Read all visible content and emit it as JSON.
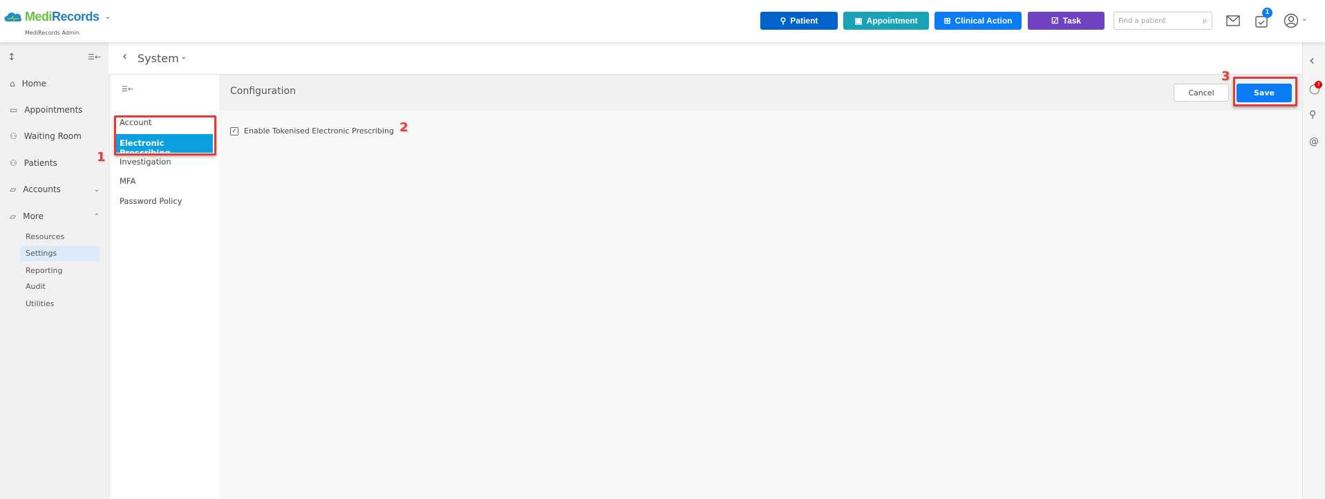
{
  "header": {
    "brand_part1": "Medi",
    "brand_part2": "Records",
    "brand_sub": "MediRecords Admin",
    "buttons": [
      {
        "label": "Patient",
        "icon": "person-add-icon",
        "color": "#0063c9"
      },
      {
        "label": "Appointment",
        "icon": "calendar-add-icon",
        "color": "#17a2b8"
      },
      {
        "label": "Clinical Action",
        "icon": "medical-bag-icon",
        "color": "#0a7cf7"
      },
      {
        "label": "Task",
        "icon": "clipboard-check-icon",
        "color": "#6f42c1"
      }
    ],
    "search_placeholder": "Find a patient",
    "tasks_badge": "1"
  },
  "sidebar": {
    "items": [
      {
        "label": "Home",
        "icon": "home-icon"
      },
      {
        "label": "Appointments",
        "icon": "calendar-icon"
      },
      {
        "label": "Waiting Room",
        "icon": "users-icon"
      },
      {
        "label": "Patients",
        "icon": "patients-icon"
      },
      {
        "label": "Accounts",
        "icon": "folder-icon"
      },
      {
        "label": "More",
        "icon": "folder-plus-icon"
      }
    ],
    "more_items": [
      "Resources",
      "Settings",
      "Reporting",
      "Audit",
      "Utilities"
    ],
    "selected": "Settings"
  },
  "page": {
    "title": "System"
  },
  "subnav": {
    "items": [
      "Account",
      "Electronic Prescribing",
      "Investigation",
      "MFA",
      "Password Policy"
    ],
    "selected": "Electronic Prescribing"
  },
  "config": {
    "title": "Configuration",
    "cancel_label": "Cancel",
    "save_label": "Save",
    "checkbox_label": "Enable Tokenised Electronic Prescribing",
    "checkbox_checked": true
  },
  "rail": {
    "chat_badge": "3"
  },
  "annotations": [
    "1",
    "2",
    "3"
  ]
}
